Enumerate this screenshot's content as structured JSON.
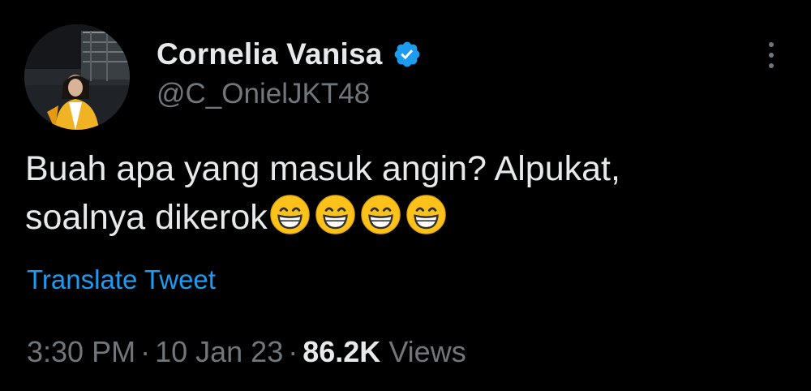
{
  "user": {
    "display_name": "Cornelia Vanisa",
    "handle": "@C_OnielJKT48",
    "verified": true,
    "avatar": "profile-photo"
  },
  "tweet": {
    "text_line1": "Buah apa yang masuk angin? Alpukat,",
    "text_line2": "soalnya dikerok",
    "emoji": [
      "grinning-face",
      "grinning-face",
      "grinning-face",
      "grinning-face"
    ],
    "translate_label": "Translate Tweet"
  },
  "meta": {
    "time": "3:30 PM",
    "separator": "·",
    "date": "10 Jan 23",
    "views_count": "86.2K",
    "views_label": "Views"
  },
  "colors": {
    "background": "#000000",
    "text": "#e7e9ea",
    "muted": "#71767b",
    "link": "#1d9bf0",
    "verified": "#1d9bf0",
    "emoji_face": "#fcc21b"
  },
  "icons": {
    "verified": "verified-badge-icon",
    "more": "more-options-icon"
  }
}
